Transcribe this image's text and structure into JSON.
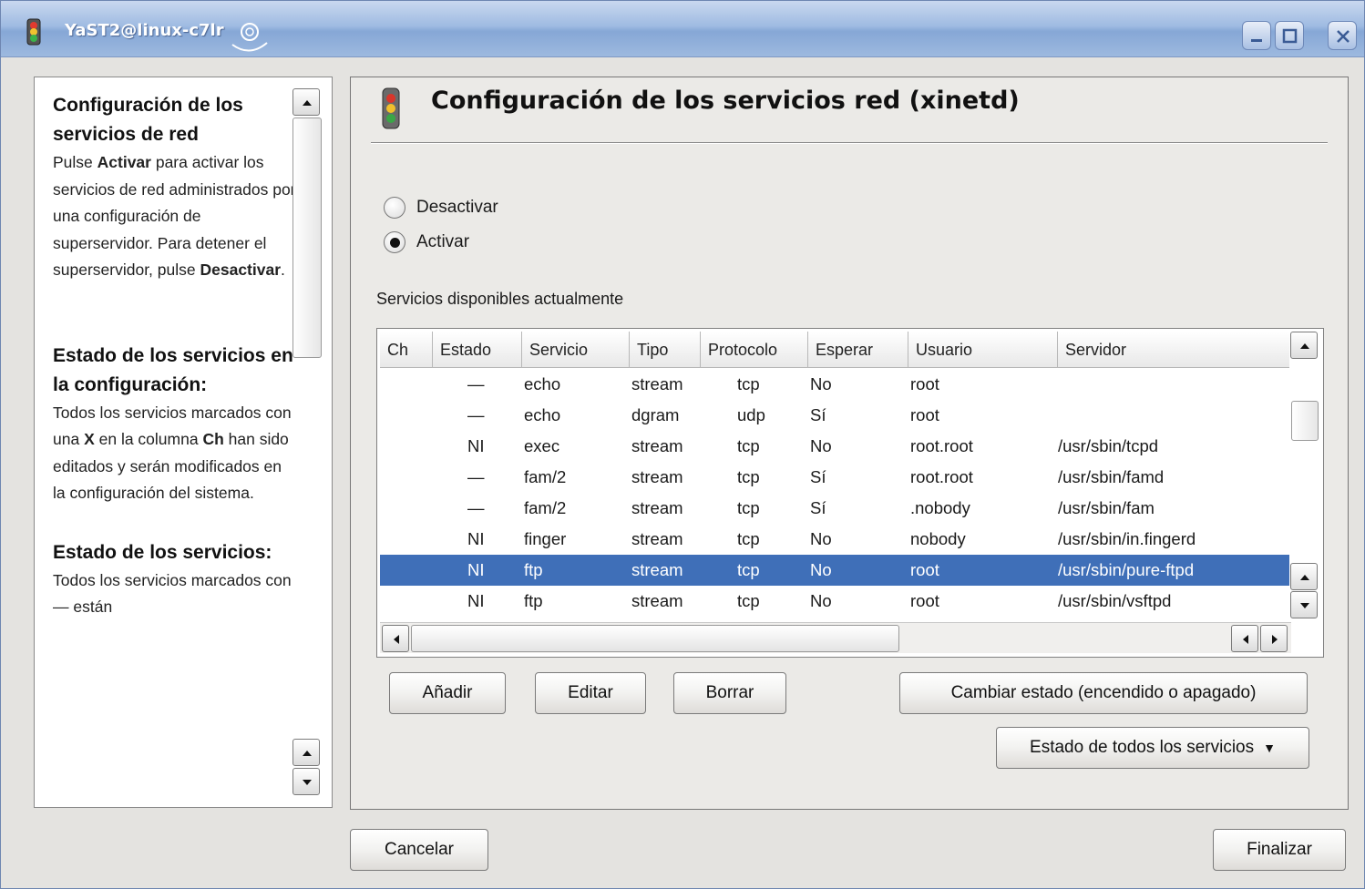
{
  "window": {
    "title": "YaST2@linux-c7lr"
  },
  "help": {
    "section1_title": "Configuración de los servicios de red",
    "section1_pre": "Pulse ",
    "section1_b1": "Activar",
    "section1_mid": " para activar los servicios de red administrados por una configuración de superservidor. Para detener el superservidor, pulse ",
    "section1_b2": "Desactivar",
    "section1_end": ".",
    "section2_title": "Estado de los servicios en la configuración:",
    "section2_pre": "Todos los servicios marcados con una ",
    "section2_b1": "X",
    "section2_mid": " en la columna ",
    "section2_b2": "Ch",
    "section2_end": " han sido editados y serán modificados en la configuración del sistema.",
    "section3_title": "Estado de los servicios:",
    "section3_text": "Todos los servicios marcados con — están"
  },
  "main": {
    "heading": "Configuración de los servicios red (xinetd)",
    "radio_deactivate": "Desactivar",
    "radio_activate": "Activar",
    "selected_mode": "Activar",
    "list_label": "Servicios disponibles actualmente",
    "columns": [
      "Ch",
      "Estado",
      "Servicio",
      "Tipo",
      "Protocolo",
      "Esperar",
      "Usuario",
      "Servidor"
    ],
    "rows": [
      {
        "ch": "",
        "estado": "—",
        "servicio": "echo",
        "tipo": "stream",
        "protocolo": "tcp",
        "esperar": "No",
        "usuario": "root",
        "servidor": ""
      },
      {
        "ch": "",
        "estado": "—",
        "servicio": "echo",
        "tipo": "dgram",
        "protocolo": "udp",
        "esperar": "Sí",
        "usuario": "root",
        "servidor": ""
      },
      {
        "ch": "",
        "estado": "NI",
        "servicio": "exec",
        "tipo": "stream",
        "protocolo": "tcp",
        "esperar": "No",
        "usuario": "root.root",
        "servidor": "/usr/sbin/tcpd"
      },
      {
        "ch": "",
        "estado": "—",
        "servicio": "fam/2",
        "tipo": "stream",
        "protocolo": "tcp",
        "esperar": "Sí",
        "usuario": "root.root",
        "servidor": "/usr/sbin/famd"
      },
      {
        "ch": "",
        "estado": "—",
        "servicio": "fam/2",
        "tipo": "stream",
        "protocolo": "tcp",
        "esperar": "Sí",
        "usuario": ".nobody",
        "servidor": "/usr/sbin/fam"
      },
      {
        "ch": "",
        "estado": "NI",
        "servicio": "finger",
        "tipo": "stream",
        "protocolo": "tcp",
        "esperar": "No",
        "usuario": "nobody",
        "servidor": "/usr/sbin/in.fingerd"
      },
      {
        "ch": "",
        "estado": "NI",
        "servicio": "ftp",
        "tipo": "stream",
        "protocolo": "tcp",
        "esperar": "No",
        "usuario": "root",
        "servidor": "/usr/sbin/pure-ftpd"
      },
      {
        "ch": "",
        "estado": "NI",
        "servicio": "ftp",
        "tipo": "stream",
        "protocolo": "tcp",
        "esperar": "No",
        "usuario": "root",
        "servidor": "/usr/sbin/vsftpd"
      }
    ],
    "selected_row_index": 6,
    "buttons": {
      "add": "Añadir",
      "edit": "Editar",
      "delete": "Borrar",
      "toggle": "Cambiar estado (encendido o apagado)",
      "all_services": "Estado de todos los servicios"
    }
  },
  "footer": {
    "cancel": "Cancelar",
    "finish": "Finalizar"
  },
  "colors": {
    "selection": "#3f6fb8",
    "titlebar": "#9fbbe2"
  }
}
